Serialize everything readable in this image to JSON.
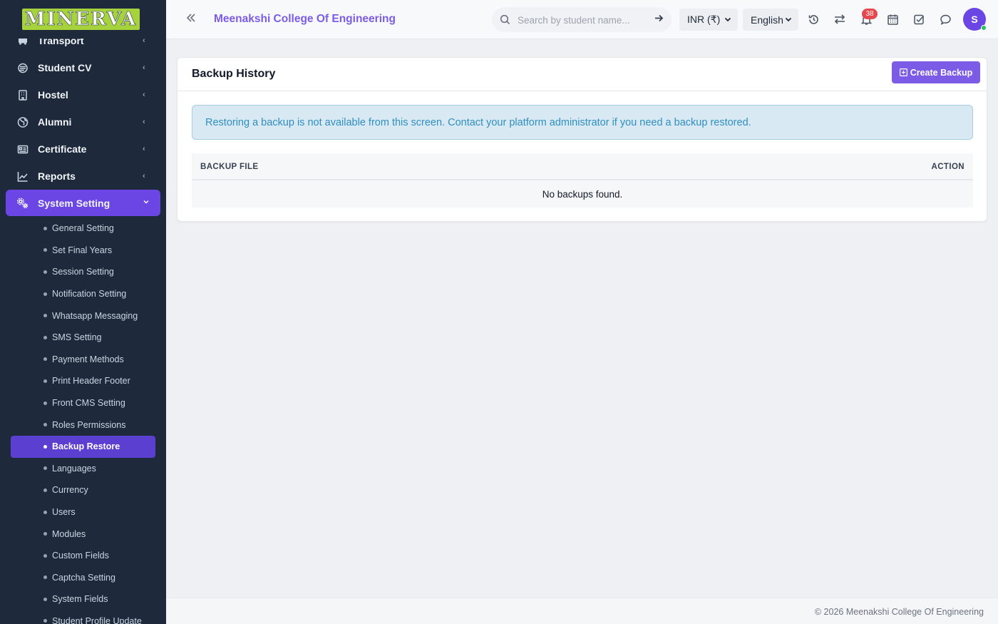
{
  "logo": {
    "text": "MINERVA"
  },
  "sidebar": {
    "items": [
      {
        "label": "Transport",
        "icon": "bus-icon"
      },
      {
        "label": "Student CV",
        "icon": "cv-icon"
      },
      {
        "label": "Hostel",
        "icon": "building-icon"
      },
      {
        "label": "Alumni",
        "icon": "globe-icon"
      },
      {
        "label": "Certificate",
        "icon": "certificate-icon"
      },
      {
        "label": "Reports",
        "icon": "chart-line-icon"
      },
      {
        "label": "System Setting",
        "icon": "gears-icon",
        "active": true
      }
    ],
    "subitems": [
      "General Setting",
      "Set Final Years",
      "Session Setting",
      "Notification Setting",
      "Whatsapp Messaging",
      "SMS Setting",
      "Payment Methods",
      "Print Header Footer",
      "Front CMS Setting",
      "Roles Permissions",
      "Backup Restore",
      "Languages",
      "Currency",
      "Users",
      "Modules",
      "Custom Fields",
      "Captcha Setting",
      "System Fields",
      "Student Profile Update"
    ],
    "active_subitem": "Backup Restore"
  },
  "header": {
    "title": "Meenakshi College Of Engineering",
    "search_placeholder": "Search by student name...",
    "currency": "INR (₹)",
    "language": "English",
    "notification_count": "38",
    "avatar_initial": "S"
  },
  "card": {
    "title": "Backup History",
    "create_button": "Create Backup",
    "alert": "Restoring a backup is not available from this screen. Contact your platform administrator if you need a backup restored.",
    "columns": [
      "BACKUP FILE",
      "ACTION"
    ],
    "empty_message": "No backups found."
  },
  "footer": {
    "text": "© 2026 Meenakshi College Of Engineering"
  },
  "colors": {
    "accent": "#7c5ce6",
    "sidebar": "#1e293b",
    "alert_bg": "#d9e9f3",
    "badge": "#e5484d"
  }
}
